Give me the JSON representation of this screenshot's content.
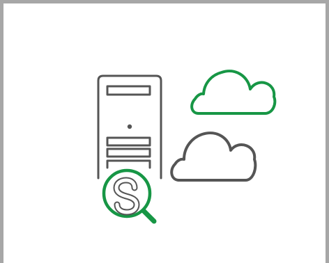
{
  "illustration": {
    "icons": [
      "server-tower-icon",
      "cloud-icon-green",
      "cloud-icon-gray",
      "qlik-search-icon"
    ],
    "colors": {
      "gray": "#555555",
      "green": "#179645",
      "frame": "#a7a7a7"
    }
  }
}
